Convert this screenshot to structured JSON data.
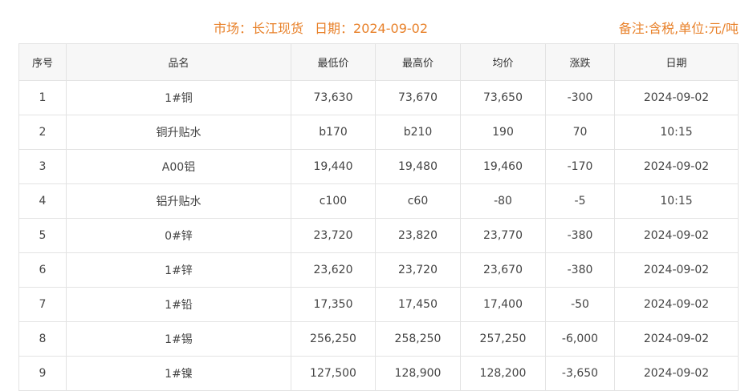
{
  "header": {
    "market_label": "市场：长江现货",
    "date_label": "日期：2024-09-02",
    "note": "备注:含税,单位:元/吨"
  },
  "table": {
    "columns": [
      "序号",
      "品名",
      "最低价",
      "最高价",
      "均价",
      "涨跌",
      "日期"
    ],
    "rows": [
      {
        "no": "1",
        "name": "1#铜",
        "low": "73,630",
        "high": "73,670",
        "avg": "73,650",
        "change": "-300",
        "dir": "down",
        "date": "2024-09-02"
      },
      {
        "no": "2",
        "name": "铜升贴水",
        "low": "b170",
        "high": "b210",
        "avg": "190",
        "change": "70",
        "dir": "up",
        "date": "10:15"
      },
      {
        "no": "3",
        "name": "A00铝",
        "low": "19,440",
        "high": "19,480",
        "avg": "19,460",
        "change": "-170",
        "dir": "down",
        "date": "2024-09-02"
      },
      {
        "no": "4",
        "name": "铝升贴水",
        "low": "c100",
        "high": "c60",
        "avg": "-80",
        "change": "-5",
        "dir": "down",
        "date": "10:15"
      },
      {
        "no": "5",
        "name": "0#锌",
        "low": "23,720",
        "high": "23,820",
        "avg": "23,770",
        "change": "-380",
        "dir": "down",
        "date": "2024-09-02"
      },
      {
        "no": "6",
        "name": "1#锌",
        "low": "23,620",
        "high": "23,720",
        "avg": "23,670",
        "change": "-380",
        "dir": "down",
        "date": "2024-09-02"
      },
      {
        "no": "7",
        "name": "1#铅",
        "low": "17,350",
        "high": "17,450",
        "avg": "17,400",
        "change": "-50",
        "dir": "down",
        "date": "2024-09-02"
      },
      {
        "no": "8",
        "name": "1#锡",
        "low": "256,250",
        "high": "258,250",
        "avg": "257,250",
        "change": "-6,000",
        "dir": "down",
        "date": "2024-09-02"
      },
      {
        "no": "9",
        "name": "1#镍",
        "low": "127,500",
        "high": "128,900",
        "avg": "128,200",
        "change": "-3,650",
        "dir": "down",
        "date": "2024-09-02"
      }
    ]
  },
  "colors": {
    "header_accent": "#e8812a",
    "change_up": "#d0021b",
    "change_down": "#1a8a2a",
    "grid_line": "#e3e3e3",
    "header_row_bg": "#f7f7f7"
  }
}
